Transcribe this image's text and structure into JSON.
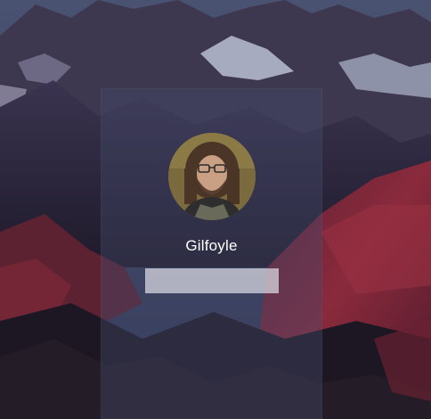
{
  "login": {
    "username": "Gilfoyle",
    "password_value": "",
    "password_placeholder": ""
  },
  "colors": {
    "sky": "#3b4260",
    "mountain_dark": "#2a2638",
    "mountain_red": "#7a2437",
    "snow": "#b9c0d4",
    "card_overlay": "rgba(70,75,110,0.38)",
    "input_bg": "#d6d6dd"
  },
  "icons": {
    "avatar": "user-photo"
  }
}
